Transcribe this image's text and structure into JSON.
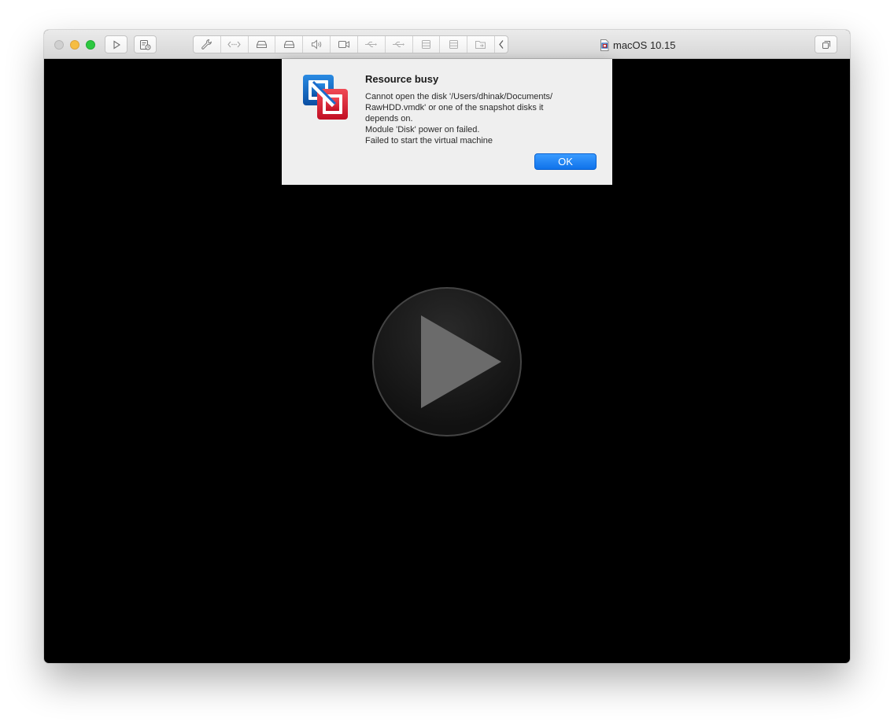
{
  "window": {
    "title": "macOS 10.15",
    "icons": {
      "close": "close-icon",
      "minimize": "minimize-icon",
      "zoom": "zoom-icon",
      "play": "play-icon",
      "snapshot": "snapshot-icon",
      "settings": "wrench-icon",
      "network": "network-icon",
      "hard_disk_1": "hard-disk-icon",
      "hard_disk_2": "hard-disk-icon",
      "sound": "speaker-icon",
      "camera": "camera-icon",
      "usb_1": "usb-icon",
      "usb_2": "usb-icon",
      "storage_1": "disk-stack-icon",
      "storage_2": "disk-stack-icon",
      "shared_folder": "shared-folder-icon",
      "collapse": "chevron-left-icon",
      "document": "vmx-document-icon",
      "fullscreen": "fullscreen-icon"
    }
  },
  "alert": {
    "title": "Resource busy",
    "message_lines": [
      "Cannot open the disk '/Users/dhinak/Documents/",
      "RawHDD.vmdk' or one of the snapshot disks it",
      "depends on.",
      "Module 'Disk' power on failed.",
      "Failed to start the virtual machine"
    ],
    "ok_label": "OK",
    "app_icon": "vmware-fusion-icon"
  },
  "colors": {
    "accent_blue": "#147EFB",
    "vm_background": "#000000",
    "close_button": "#D0D0D0",
    "minimize_button": "#F6BD42",
    "zoom_button": "#2CC840"
  }
}
